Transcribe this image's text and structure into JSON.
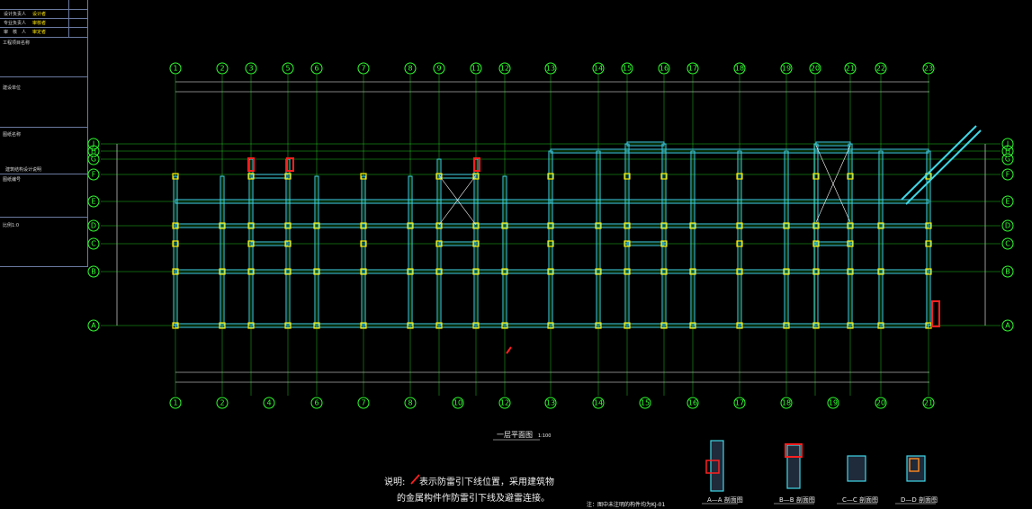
{
  "drawing": {
    "plan_title": "一层平面图",
    "plan_scale": "1:100",
    "sheet_note": "注：图中未注明的构件均为KJ-01",
    "note_label": "说明:",
    "note_line1": "表示防雷引下线位置，采用建筑物",
    "note_line2": "的金属构件作防雷引下线及避雷连接。"
  },
  "title_block": {
    "rows": [
      {
        "label": "设计负责人",
        "value": "设计者"
      },
      {
        "label": "专业负责人",
        "value": "审核者"
      },
      {
        "label": "审　核　人",
        "value": "审定者"
      }
    ],
    "sections": [
      "工程项目名称",
      "建设单位",
      "图纸名称",
      "建筑结构设计说明",
      "图纸编号",
      "比例1:0"
    ]
  },
  "axes": {
    "top": [
      "1",
      "2",
      "3",
      "5",
      "6",
      "7",
      "8",
      "9",
      "11",
      "12",
      "13",
      "14",
      "15",
      "16",
      "17",
      "18",
      "19",
      "20",
      "21",
      "22",
      "23"
    ],
    "bottom": [
      "1",
      "2",
      "4",
      "6",
      "7",
      "8",
      "10",
      "12",
      "13",
      "14",
      "15",
      "16",
      "17",
      "18",
      "19",
      "20",
      "21",
      "22",
      "23"
    ],
    "left": [
      "J",
      "H",
      "G",
      "F",
      "E",
      "D",
      "C",
      "B",
      "A"
    ],
    "right": [
      "J",
      "H",
      "G",
      "F",
      "E",
      "D",
      "C",
      "B",
      "A"
    ]
  },
  "sections": [
    {
      "id": "A-A",
      "label": "A—A 剖面图"
    },
    {
      "id": "B-B",
      "label": "B—B 剖面图"
    },
    {
      "id": "C-C",
      "label": "C—C 剖面图"
    },
    {
      "id": "D-D",
      "label": "D—D 剖面图"
    }
  ],
  "colors": {
    "grid": "#2fff2f",
    "wall": "#3fd8e8",
    "column": "#ffe800",
    "dimension": "#ffffff",
    "accent": "#ff2020"
  }
}
